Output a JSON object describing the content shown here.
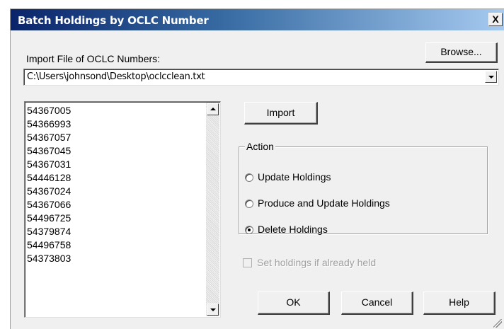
{
  "window": {
    "title": "Batch Holdings by OCLC Number",
    "close_label": "X"
  },
  "import_file": {
    "label": "Import File of OCLC Numbers:",
    "browse_label": "Browse...",
    "path_value": "C:\\Users\\johnsond\\Desktop\\oclcclean.txt"
  },
  "oclc_numbers": [
    "54367005",
    "54366993",
    "54367057",
    "54367045",
    "54367031",
    "54446128",
    "54367024",
    "54367066",
    "54496725",
    "54379874",
    "54496758",
    "54373803"
  ],
  "import_button_label": "Import",
  "action": {
    "legend": "Action",
    "options": [
      {
        "label": "Update Holdings",
        "checked": false
      },
      {
        "label": "Produce and Update Holdings",
        "checked": false
      },
      {
        "label": "Delete Holdings",
        "checked": true
      }
    ]
  },
  "set_holdings_checkbox": {
    "label": "Set holdings if already held",
    "checked": false,
    "enabled": false
  },
  "buttons": {
    "ok": "OK",
    "cancel": "Cancel",
    "help": "Help"
  }
}
